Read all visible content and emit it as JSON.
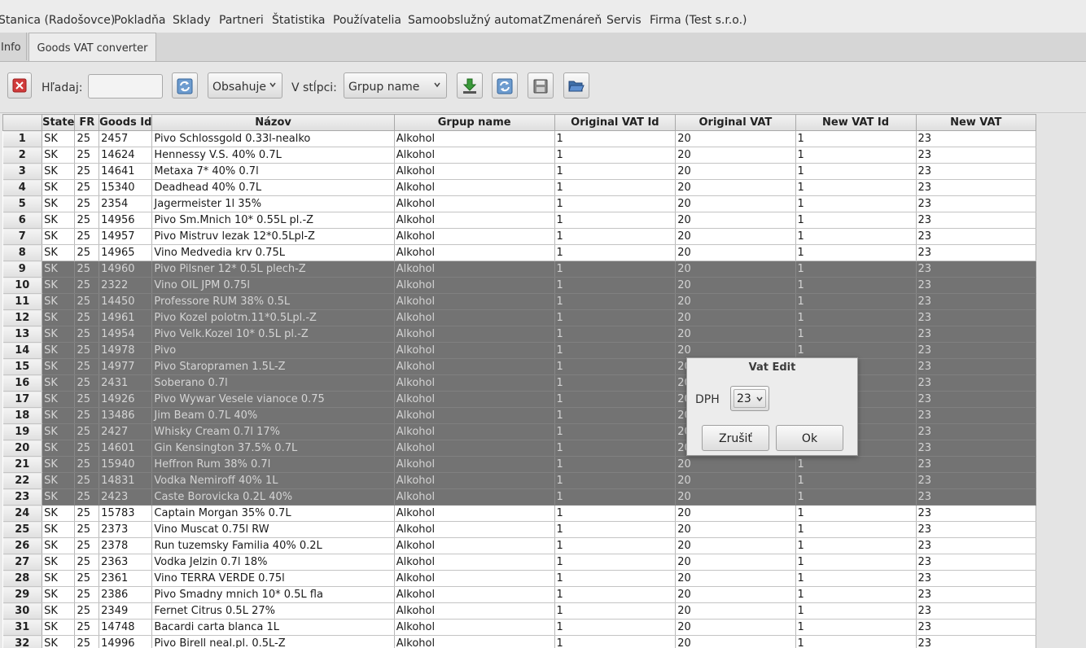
{
  "menu": [
    "Stanica (Radošovce)",
    "Pokladňa",
    "Sklady",
    "Partneri",
    "Štatistika",
    "Používatelia",
    "Samoobslužný automat",
    "Zmenáreň",
    "Servis",
    "Firma (Test s.r.o.)"
  ],
  "tabs": [
    "Info",
    "Goods VAT converter"
  ],
  "toolbar": {
    "search_label": "Hľadaj:",
    "search_value": "",
    "match_mode": "Obsahuje",
    "column_label": "V stĺpci:",
    "column_value": "Grpup name"
  },
  "colors": {
    "selection": "#737373",
    "accent_green": "#2e8b2e",
    "close_red": "#d03030"
  },
  "table": {
    "headers": [
      "State",
      "FR",
      "Goods Id",
      "Názov",
      "Grpup name",
      "Original VAT Id",
      "Original VAT",
      "New VAT Id",
      "New VAT"
    ],
    "selected_rows": [
      9,
      23
    ],
    "rows": [
      [
        "SK",
        "25",
        "2457",
        "Pivo Schlossgold 0.33l-nealko",
        "Alkohol",
        "1",
        "20",
        "1",
        "23"
      ],
      [
        "SK",
        "25",
        "14624",
        "Hennessy V.S. 40% 0.7L",
        "Alkohol",
        "1",
        "20",
        "1",
        "23"
      ],
      [
        "SK",
        "25",
        "14641",
        "Metaxa 7* 40% 0.7l",
        "Alkohol",
        "1",
        "20",
        "1",
        "23"
      ],
      [
        "SK",
        "25",
        "15340",
        "Deadhead 40% 0.7L",
        "Alkohol",
        "1",
        "20",
        "1",
        "23"
      ],
      [
        "SK",
        "25",
        "2354",
        "Jagermeister 1l  35%",
        "Alkohol",
        "1",
        "20",
        "1",
        "23"
      ],
      [
        "SK",
        "25",
        "14956",
        "Pivo Sm.Mnich 10* 0.55L pl.-Z",
        "Alkohol",
        "1",
        "20",
        "1",
        "23"
      ],
      [
        "SK",
        "25",
        "14957",
        "Pivo Mistruv lezak 12*0.5Lpl-Z",
        "Alkohol",
        "1",
        "20",
        "1",
        "23"
      ],
      [
        "SK",
        "25",
        "14965",
        "Vino Medvedia krv 0.75L",
        "Alkohol",
        "1",
        "20",
        "1",
        "23"
      ],
      [
        "SK",
        "25",
        "14960",
        "Pivo Pilsner 12* 0.5L plech-Z",
        "Alkohol",
        "1",
        "20",
        "1",
        "23"
      ],
      [
        "SK",
        "25",
        "2322",
        "Vino OIL JPM 0.75l",
        "Alkohol",
        "1",
        "20",
        "1",
        "23"
      ],
      [
        "SK",
        "25",
        "14450",
        "Professore RUM 38% 0.5L",
        "Alkohol",
        "1",
        "20",
        "1",
        "23"
      ],
      [
        "SK",
        "25",
        "14961",
        "Pivo Kozel polotm.11*0.5Lpl.-Z",
        "Alkohol",
        "1",
        "20",
        "1",
        "23"
      ],
      [
        "SK",
        "25",
        "14954",
        "Pivo Velk.Kozel 10* 0.5L pl.-Z",
        "Alkohol",
        "1",
        "20",
        "1",
        "23"
      ],
      [
        "SK",
        "25",
        "14978",
        "Pivo",
        "Alkohol",
        "1",
        "20",
        "1",
        "23"
      ],
      [
        "SK",
        "25",
        "14977",
        "Pivo Staropramen 1.5L-Z",
        "Alkohol",
        "1",
        "20",
        "1",
        "23"
      ],
      [
        "SK",
        "25",
        "2431",
        "Soberano 0.7l",
        "Alkohol",
        "1",
        "20",
        "1",
        "23"
      ],
      [
        "SK",
        "25",
        "14926",
        "Pivo Wywar Vesele vianoce 0.75",
        "Alkohol",
        "1",
        "20",
        "1",
        "23"
      ],
      [
        "SK",
        "25",
        "13486",
        "Jim Beam 0.7L 40%",
        "Alkohol",
        "1",
        "20",
        "1",
        "23"
      ],
      [
        "SK",
        "25",
        "2427",
        "Whisky Cream 0.7l  17%",
        "Alkohol",
        "1",
        "20",
        "1",
        "23"
      ],
      [
        "SK",
        "25",
        "14601",
        "Gin Kensington 37.5% 0.7L",
        "Alkohol",
        "1",
        "20",
        "1",
        "23"
      ],
      [
        "SK",
        "25",
        "15940",
        "Heffron Rum 38% 0.7l",
        "Alkohol",
        "1",
        "20",
        "1",
        "23"
      ],
      [
        "SK",
        "25",
        "14831",
        "Vodka Nemiroff 40%  1L",
        "Alkohol",
        "1",
        "20",
        "1",
        "23"
      ],
      [
        "SK",
        "25",
        "2423",
        "Caste Borovicka 0.2L 40%",
        "Alkohol",
        "1",
        "20",
        "1",
        "23"
      ],
      [
        "SK",
        "25",
        "15783",
        "Captain Morgan 35% 0.7L",
        "Alkohol",
        "1",
        "20",
        "1",
        "23"
      ],
      [
        "SK",
        "25",
        "2373",
        "Vino Muscat 0.75l RW",
        "Alkohol",
        "1",
        "20",
        "1",
        "23"
      ],
      [
        "SK",
        "25",
        "2378",
        "Run tuzemsky Familia 40% 0.2L",
        "Alkohol",
        "1",
        "20",
        "1",
        "23"
      ],
      [
        "SK",
        "25",
        "2363",
        "Vodka Jelzin 0.7l  18%",
        "Alkohol",
        "1",
        "20",
        "1",
        "23"
      ],
      [
        "SK",
        "25",
        "2361",
        "Vino TERRA VERDE 0.75l",
        "Alkohol",
        "1",
        "20",
        "1",
        "23"
      ],
      [
        "SK",
        "25",
        "2386",
        "Pivo Smadny mnich 10* 0.5L fla",
        "Alkohol",
        "1",
        "20",
        "1",
        "23"
      ],
      [
        "SK",
        "25",
        "2349",
        "Fernet Citrus 0.5L 27%",
        "Alkohol",
        "1",
        "20",
        "1",
        "23"
      ],
      [
        "SK",
        "25",
        "14748",
        "Bacardi carta blanca 1L",
        "Alkohol",
        "1",
        "20",
        "1",
        "23"
      ],
      [
        "SK",
        "25",
        "14996",
        "Pivo Birell neal.pl. 0.5L-Z",
        "Alkohol",
        "1",
        "20",
        "1",
        "23"
      ]
    ]
  },
  "dialog": {
    "title": "Vat Edit",
    "field_label": "DPH",
    "field_value": "23",
    "cancel_label": "Zrušiť",
    "ok_label": "Ok"
  }
}
